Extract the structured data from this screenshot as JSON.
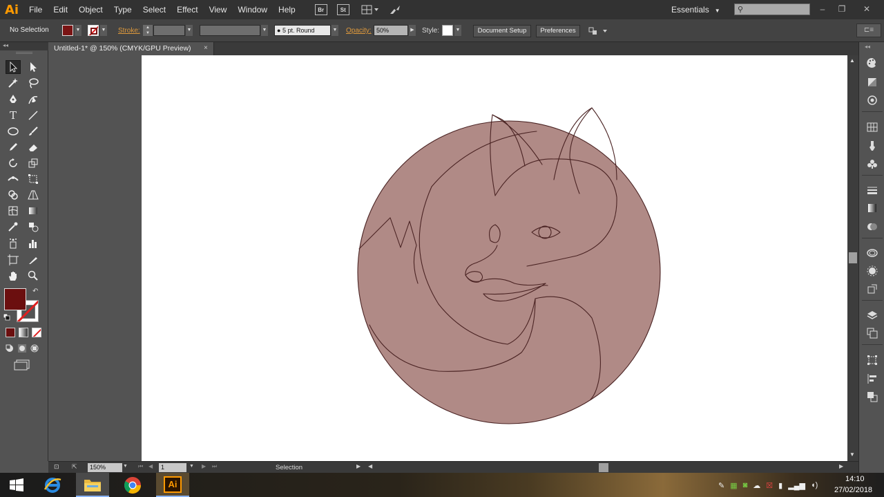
{
  "menubar": {
    "logo": "Ai",
    "items": [
      "File",
      "Edit",
      "Object",
      "Type",
      "Select",
      "Effect",
      "View",
      "Window",
      "Help"
    ],
    "bridge_label": "Br",
    "stock_label": "St",
    "workspace": "Essentials",
    "search_placeholder": ""
  },
  "control": {
    "selection_state": "No Selection",
    "stroke_label": "Stroke:",
    "brush": "5 pt. Round",
    "opacity_label": "Opacity:",
    "opacity_value": "50%",
    "style_label": "Style:",
    "document_setup": "Document Setup",
    "preferences": "Preferences",
    "fill_color": "#7a1414"
  },
  "document": {
    "tab_title": "Untitled-1* @ 150% (CMYK/GPU Preview)",
    "close_glyph": "×"
  },
  "status": {
    "zoom": "150%",
    "page": "1",
    "tool": "Selection"
  },
  "colors": {
    "fox_fill": "#b08a86",
    "fox_stroke": "#4a2323",
    "fill_swatch": "#6b0f0f"
  },
  "taskbar": {
    "time": "14:10",
    "date": "27/02/2018",
    "apps": [
      "windows-start",
      "internet-explorer",
      "file-explorer",
      "chrome",
      "illustrator"
    ],
    "illustrator_label": "Ai"
  }
}
